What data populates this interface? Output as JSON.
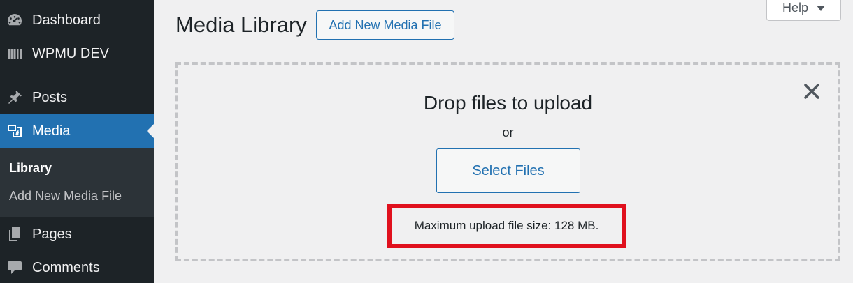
{
  "sidebar": {
    "items": [
      {
        "label": "Dashboard",
        "icon": "dashboard-icon"
      },
      {
        "label": "WPMU DEV",
        "icon": "wpmudev-icon"
      },
      {
        "label": "Posts",
        "icon": "pin-icon"
      },
      {
        "label": "Media",
        "icon": "media-icon",
        "active": true
      },
      {
        "label": "Pages",
        "icon": "page-icon"
      },
      {
        "label": "Comments",
        "icon": "comment-icon"
      }
    ],
    "submenu": [
      {
        "label": "Library",
        "current": true
      },
      {
        "label": "Add New Media File"
      }
    ]
  },
  "header": {
    "title": "Media Library",
    "add_new_label": "Add New Media File",
    "help_label": "Help"
  },
  "upload": {
    "drop_title": "Drop files to upload",
    "or_text": "or",
    "select_label": "Select Files",
    "max_size_text": "Maximum upload file size: 128 MB."
  },
  "colors": {
    "sidebar_bg": "#1d2327",
    "accent": "#2271b1",
    "highlight": "#e0101d",
    "page_bg": "#f0f0f1"
  }
}
